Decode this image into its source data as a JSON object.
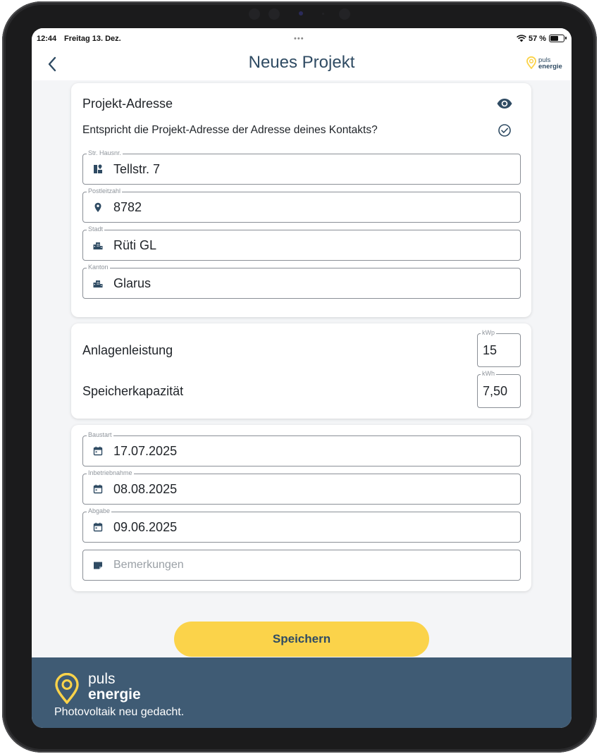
{
  "status_bar": {
    "time": "12:44",
    "date": "Freitag 13. Dez.",
    "battery_percent_label": "57 %",
    "battery_level": 0.57,
    "multitask_dots": "•••"
  },
  "header": {
    "title": "Neues Projekt",
    "logo_line1": "puls",
    "logo_line2": "energie"
  },
  "address_card": {
    "title": "Projekt-Adresse",
    "question": "Entspricht die Projekt-Adresse der Adresse deines Kontakts?",
    "fields": [
      {
        "label": "Str. Hausnr.",
        "value": "Tellstr. 7",
        "icon": "street-icon"
      },
      {
        "label": "Postleitzahl",
        "value": "8782",
        "icon": "location-pin-icon"
      },
      {
        "label": "Stadt",
        "value": "Rüti GL",
        "icon": "city-icon"
      },
      {
        "label": "Kanton",
        "value": "Glarus",
        "icon": "city-icon"
      }
    ]
  },
  "capacity_card": {
    "rows": [
      {
        "label": "Anlagenleistung",
        "unit": "kWp",
        "value": "15"
      },
      {
        "label": "Speicherkapazität",
        "unit": "kWh",
        "value": "7,50"
      }
    ]
  },
  "dates_card": {
    "fields": [
      {
        "label": "Baustart",
        "value": "17.07.2025",
        "icon": "calendar-icon"
      },
      {
        "label": "Inbetriebnahme",
        "value": "08.08.2025",
        "icon": "calendar-icon"
      },
      {
        "label": "Abgabe",
        "value": "09.06.2025",
        "icon": "calendar-icon"
      }
    ],
    "remarks_placeholder": "Bemerkungen"
  },
  "save_button_label": "Speichern",
  "footer": {
    "brand_line1": "puls",
    "brand_line2": "energie",
    "tagline": "Photovoltaik neu gedacht."
  },
  "colors": {
    "primary": "#2f4b63",
    "accent_yellow": "#fbd34a",
    "footer_bg": "#3f5b74",
    "background": "#f4f5f7"
  }
}
